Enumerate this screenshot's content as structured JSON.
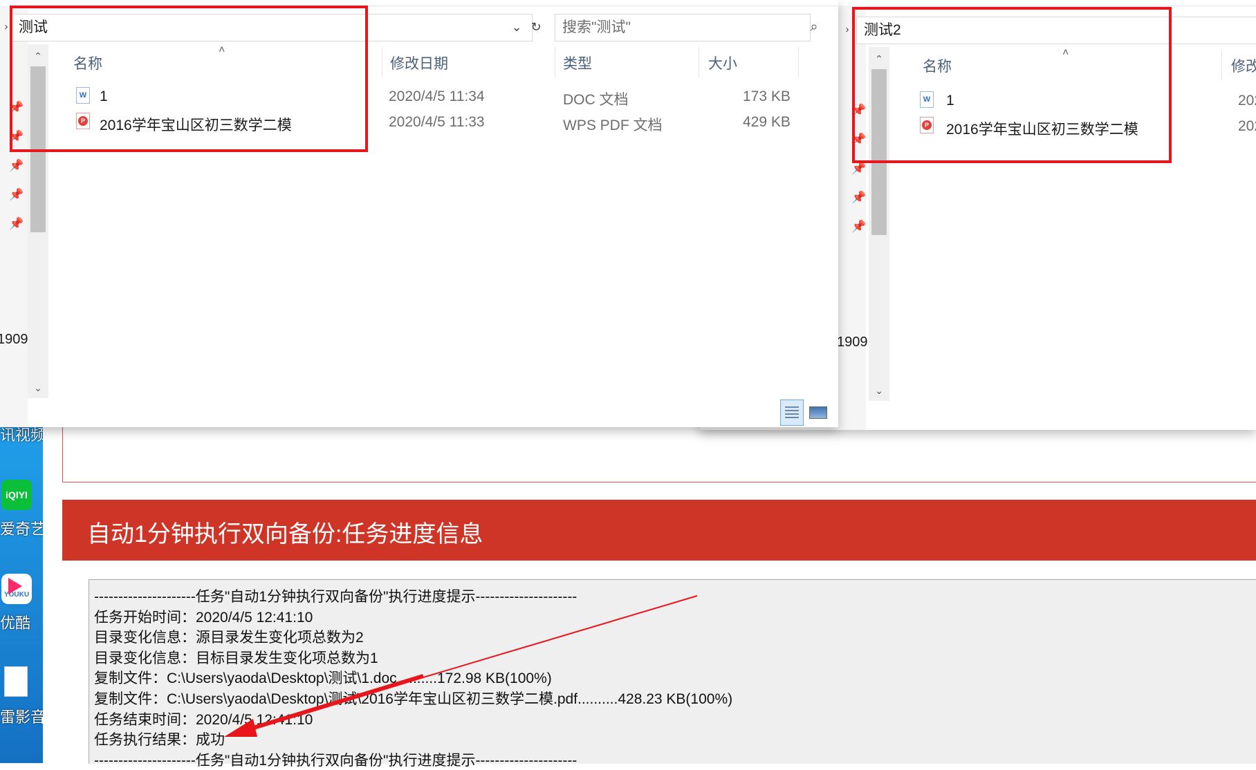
{
  "desktop": {
    "items": [
      {
        "label": "讯视频",
        "icon": "video-icon"
      },
      {
        "label": "爱奇艺",
        "icon": "iqiyi-icon",
        "badge": "iQIYI"
      },
      {
        "label": "优酷",
        "icon": "youku-icon",
        "badge": "YOUKU"
      },
      {
        "label": "雷影音",
        "icon": "file-icon"
      }
    ]
  },
  "window_left": {
    "address": "测试",
    "search_placeholder": "搜索\"测试\"",
    "side_number": "1909",
    "columns": {
      "name": "名称",
      "modified": "修改日期",
      "type": "类型",
      "size": "大小"
    },
    "files": [
      {
        "name": "1",
        "modified": "2020/4/5 11:34",
        "type": "DOC 文档",
        "size": "173 KB",
        "icon": "word-icon"
      },
      {
        "name": "2016学年宝山区初三数学二模",
        "modified": "2020/4/5 11:33",
        "type": "WPS PDF 文档",
        "size": "429 KB",
        "icon": "pdf-icon"
      }
    ]
  },
  "window_right": {
    "address": "测试2",
    "side_number": "1909",
    "columns": {
      "name": "名称",
      "modified": "修改"
    },
    "files": [
      {
        "name": "1",
        "modified": "202",
        "icon": "word-icon"
      },
      {
        "name": "2016学年宝山区初三数学二模",
        "modified": "202",
        "icon": "pdf-icon"
      }
    ]
  },
  "app": {
    "banner_title": "自动1分钟执行双向备份:任务进度信息",
    "log_lines": [
      "---------------------任务\"自动1分钟执行双向备份\"执行进度提示---------------------",
      "任务开始时间：2020/4/5 12:41:10",
      "目录变化信息：源目录发生变化项总数为2",
      "目录变化信息：目标目录发生变化项总数为1",
      "复制文件：C:\\Users\\yaoda\\Desktop\\测试\\1.doc..........172.98 KB(100%)",
      "复制文件：C:\\Users\\yaoda\\Desktop\\测试\\2016学年宝山区初三数学二模.pdf..........428.23 KB(100%)",
      "任务结束时间：2020/4/5 12:41:10",
      "任务执行结果：成功",
      "---------------------任务\"自动1分钟执行双向备份\"执行进度提示---------------------"
    ]
  },
  "colors": {
    "annotation_red": "#e8161b",
    "banner_red": "#cf3527",
    "desktop_blue": "#1f9be6"
  }
}
